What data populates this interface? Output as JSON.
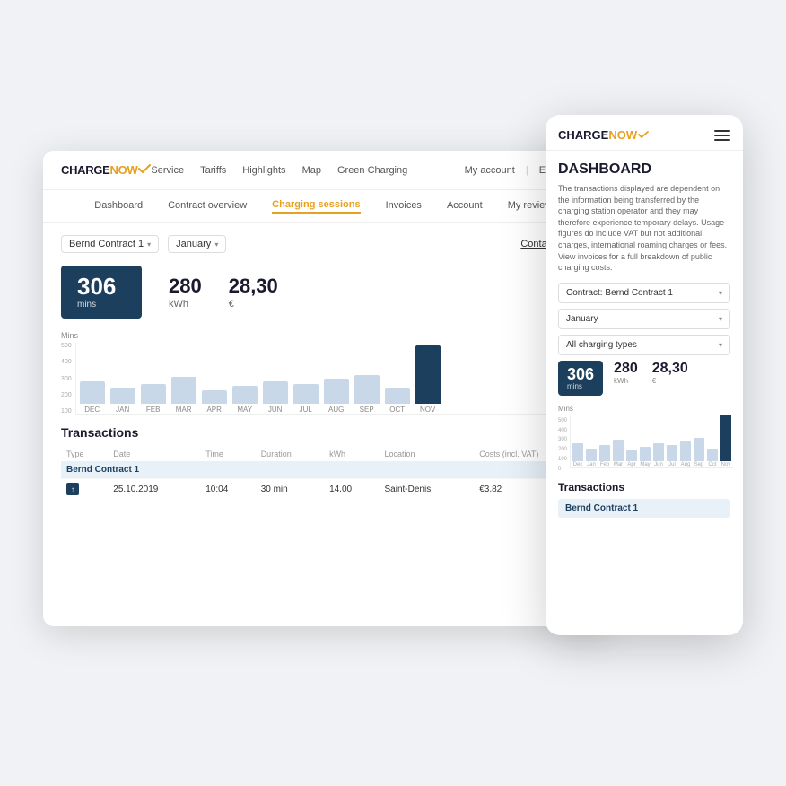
{
  "brand": {
    "name_charge": "CHARGE",
    "name_now": "NOW",
    "logo_label": "CHARGENOW"
  },
  "desktop": {
    "topnav": {
      "links": [
        "Service",
        "Tariffs",
        "Highlights",
        "Map",
        "Green Charging"
      ],
      "right": [
        "My account",
        "EN",
        "globe-icon"
      ]
    },
    "subnav": {
      "items": [
        "Dashboard",
        "Contract overview",
        "Charging sessions",
        "Invoices",
        "Account",
        "My reviews"
      ],
      "active": "Charging sessions"
    },
    "filters": {
      "contract": "Bernd Contract 1",
      "month": "January",
      "contact_support": "Contact support"
    },
    "stats": {
      "mins_value": "306",
      "mins_label": "mins",
      "kwh_value": "280",
      "kwh_label": "kWh",
      "cost_value": "28,30",
      "cost_label": "€"
    },
    "chart": {
      "y_label": "Mins",
      "y_ticks": [
        "500",
        "400",
        "300",
        "200",
        "100"
      ],
      "months": [
        "DEC",
        "JAN",
        "FEB",
        "MAR",
        "APR",
        "MAY",
        "JUN",
        "JUL",
        "AUG",
        "SEP",
        "OCT",
        "NOV"
      ],
      "heights": [
        25,
        18,
        22,
        30,
        15,
        20,
        25,
        22,
        28,
        32,
        18,
        65
      ]
    },
    "transactions": {
      "title": "Transactions",
      "columns": [
        "Type",
        "Date",
        "Time",
        "Duration",
        "kWh",
        "Location",
        "Costs (incl. VAT)"
      ],
      "contract_row": "Bernd Contract 1",
      "rows": [
        {
          "type": "↑",
          "date": "25.10.2019",
          "time": "10:04",
          "duration": "30 min",
          "kwh": "14.00",
          "location": "Saint-Denis",
          "cost": "€3.82"
        }
      ]
    }
  },
  "mobile": {
    "title": "DASHBOARD",
    "description": "The transactions displayed are dependent on the information being transferred by the charging station operator and they may therefore experience temporary delays. Usage figures do include VAT but not additional charges, international roaming charges or fees. View invoices for a full breakdown of public charging costs.",
    "filters": {
      "contract": "Contract: Bernd Contract 1",
      "month": "January",
      "charging_type": "All charging types"
    },
    "stats": {
      "mins_value": "306",
      "mins_label": "mins",
      "kwh_value": "280",
      "kwh_label": "kWh",
      "cost_value": "28,30",
      "cost_label": "€"
    },
    "chart": {
      "y_label": "Mins",
      "y_ticks": [
        "500",
        "400",
        "300",
        "200",
        "100",
        "0"
      ],
      "months": [
        "Dec",
        "Jan",
        "Feb",
        "Mar",
        "Apr",
        "May",
        "Jun",
        "Jul",
        "Aug",
        "Sep",
        "Oct",
        "Nov"
      ],
      "heights": [
        20,
        14,
        18,
        24,
        12,
        16,
        20,
        18,
        22,
        26,
        14,
        52
      ]
    },
    "transactions": {
      "title": "Transactions",
      "contract_row": "Bernd Contract 1"
    },
    "all_charging_label": "All charging"
  }
}
